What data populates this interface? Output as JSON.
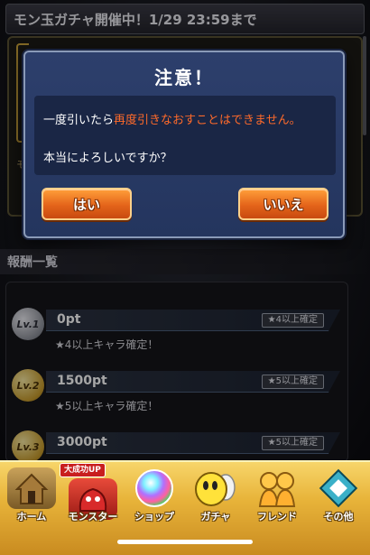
{
  "banner": {
    "text": "モン玉ガチャ開催中！1/29 23:59まで"
  },
  "gacha_panel": {
    "partial_label": "モ"
  },
  "rewards": {
    "header": "報酬一覧",
    "items": [
      {
        "level": "Lv.1",
        "points": "0pt",
        "tag": "★4以上確定",
        "description": "★4以上キャラ確定！"
      },
      {
        "level": "Lv.2",
        "points": "1500pt",
        "tag": "★5以上確定",
        "description": "★5以上キャラ確定！"
      },
      {
        "level": "Lv.3",
        "points": "3000pt",
        "tag": "★5以上確定",
        "description": ""
      }
    ]
  },
  "dialog": {
    "title": "注意！",
    "message_prefix": "一度引いたら",
    "message_warning": "再度引きなおすことはできません。",
    "question": "本当によろしいですか？",
    "yes_label": "はい",
    "no_label": "いいえ"
  },
  "nav": {
    "badge": "大成功UP",
    "items": [
      {
        "label": "ホーム",
        "icon": "home-icon"
      },
      {
        "label": "モンスター",
        "icon": "monster-icon"
      },
      {
        "label": "ショップ",
        "icon": "shop-orb-icon"
      },
      {
        "label": "ガチャ",
        "icon": "gacha-egg-icon"
      },
      {
        "label": "フレンド",
        "icon": "friends-icon"
      },
      {
        "label": "その他",
        "icon": "other-icon"
      }
    ]
  },
  "colors": {
    "warning_text": "#ff6a2a",
    "button_orange": "#e4641a",
    "dialog_blue": "#2d3f6c",
    "nav_gold": "#e8b43a"
  }
}
